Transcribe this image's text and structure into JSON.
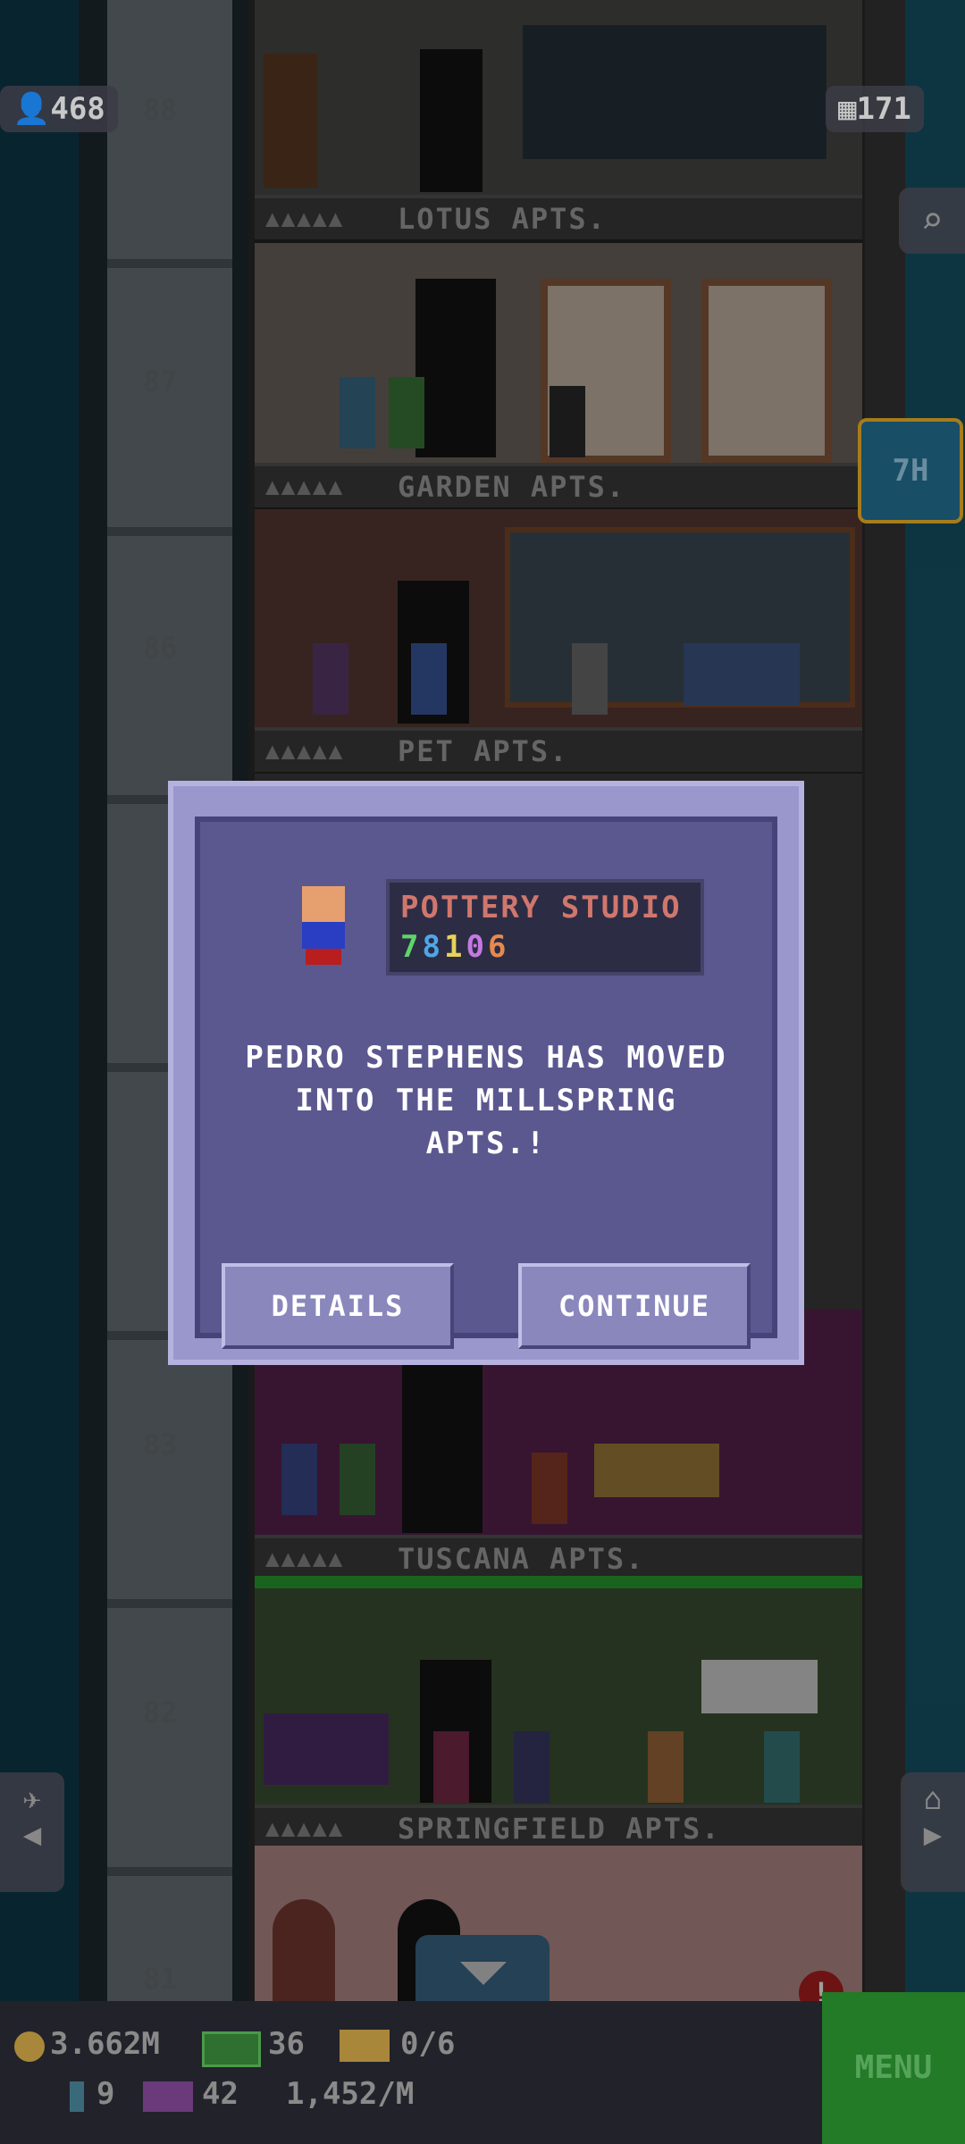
{
  "hud": {
    "population": "468",
    "floors_count": "171",
    "elevator_time": "7H"
  },
  "floors": [
    {
      "number": "88",
      "name": "LOTUS APTS.",
      "dots": "▲▲▲▲▲"
    },
    {
      "number": "87",
      "name": "GARDEN APTS.",
      "dots": "▲▲▲▲▲"
    },
    {
      "number": "86",
      "name": "PET APTS.",
      "dots": "▲▲▲▲▲"
    },
    {
      "number": "83",
      "name": "TUSCANA APTS.",
      "dots": "▲▲▲▲▲"
    },
    {
      "number": "82",
      "name": "SPRINGFIELD APTS.",
      "dots": "▲▲▲▲▲"
    },
    {
      "number": "81",
      "name": "",
      "dots": ""
    }
  ],
  "dialog": {
    "business_name": "POTTERY STUDIO",
    "business_values": [
      "7",
      "8",
      "1",
      "0",
      "6"
    ],
    "value_colors": [
      "#5fd46b",
      "#4ea6e6",
      "#e6d35a",
      "#c479e0",
      "#e68a4e"
    ],
    "message": "PEDRO STEPHENS HAS MOVED INTO THE MILLSPRING APTS.!",
    "details_label": "DETAILS",
    "continue_label": "CONTINUE"
  },
  "bottom_bar": {
    "coins": "3.662M",
    "bux": "36",
    "vip_tickets": "0/6",
    "tool_count": "9",
    "mission_count": "42",
    "income_rate": "1,452/M",
    "menu_label": "MENU"
  },
  "icons": {
    "population": "person-icon",
    "floors": "building-icon",
    "search": "magnifier-icon",
    "elevator_up": "plane-icon",
    "home": "home-icon",
    "coin": "coin-icon",
    "bux": "bux-icon",
    "ticket": "ticket-icon"
  }
}
